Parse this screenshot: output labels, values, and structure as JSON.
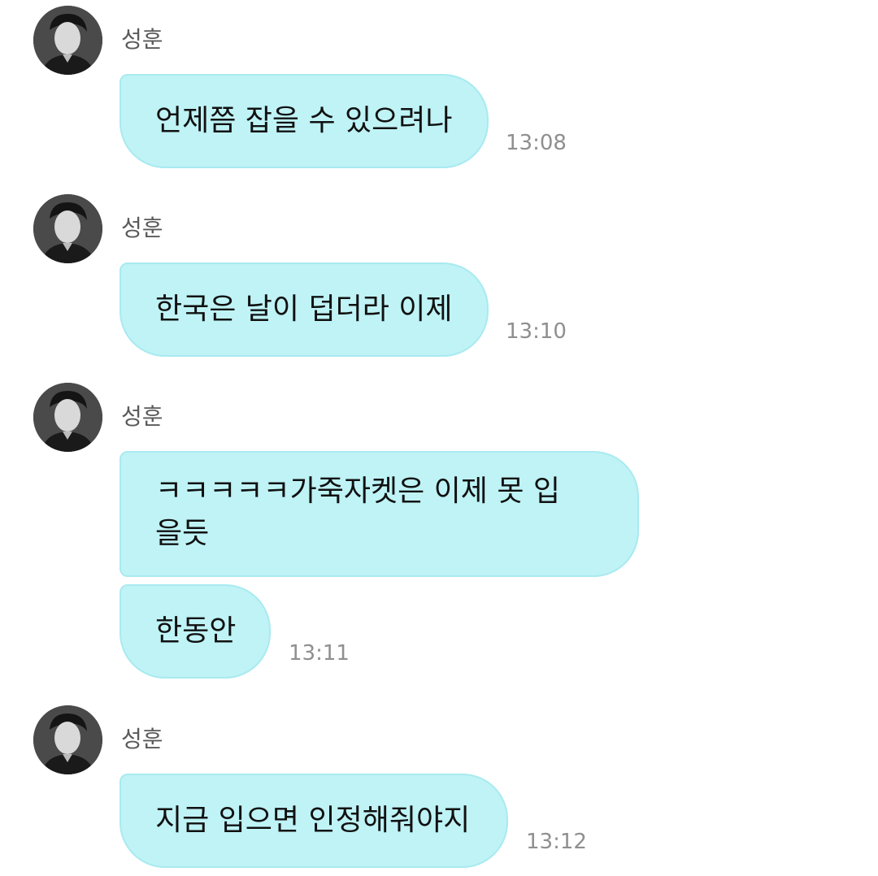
{
  "messages": [
    {
      "sender": "성훈",
      "lines": [
        "언제쯤 잡을 수 있으려나"
      ],
      "time": "13:08"
    },
    {
      "sender": "성훈",
      "lines": [
        "한국은 날이 덥더라 이제"
      ],
      "time": "13:10"
    },
    {
      "sender": "성훈",
      "lines": [
        "ㅋㅋㅋㅋㅋ가죽자켓은 이제 못 입을듯",
        "한동안"
      ],
      "time": "13:11"
    },
    {
      "sender": "성훈",
      "lines": [
        "지금 입으면 인정해줘야지"
      ],
      "time": "13:12"
    }
  ],
  "colors": {
    "bubble": "#bff3f6",
    "bubble_border": "#a9eaf0",
    "time": "#8f8f8f",
    "sender": "#5a5a5a"
  },
  "icons": {
    "avatar": "profile-photo-avatar"
  }
}
